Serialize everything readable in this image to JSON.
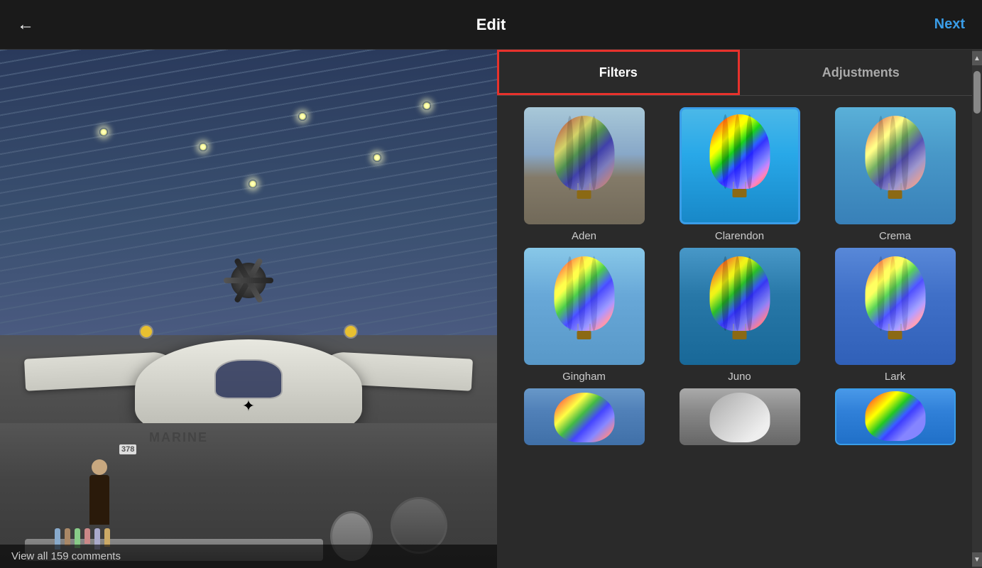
{
  "header": {
    "back_icon": "←",
    "title": "Edit",
    "next_label": "Next"
  },
  "tabs": [
    {
      "id": "filters",
      "label": "Filters",
      "active": true
    },
    {
      "id": "adjustments",
      "label": "Adjustments",
      "active": false
    }
  ],
  "filters": [
    {
      "id": "aden",
      "name": "Aden",
      "selected": false
    },
    {
      "id": "clarendon",
      "name": "Clarendon",
      "selected": true
    },
    {
      "id": "crema",
      "name": "Crema",
      "selected": false
    },
    {
      "id": "gingham",
      "name": "Gingham",
      "selected": false
    },
    {
      "id": "juno",
      "name": "Juno",
      "selected": false
    },
    {
      "id": "lark",
      "name": "Lark",
      "selected": false
    }
  ],
  "bottom_caption": "View all 159 comments",
  "colors": {
    "accent_blue": "#3a9de8",
    "active_border": "#e8322c",
    "bg_dark": "#1a1a1a",
    "bg_panel": "#2a2a2a"
  }
}
